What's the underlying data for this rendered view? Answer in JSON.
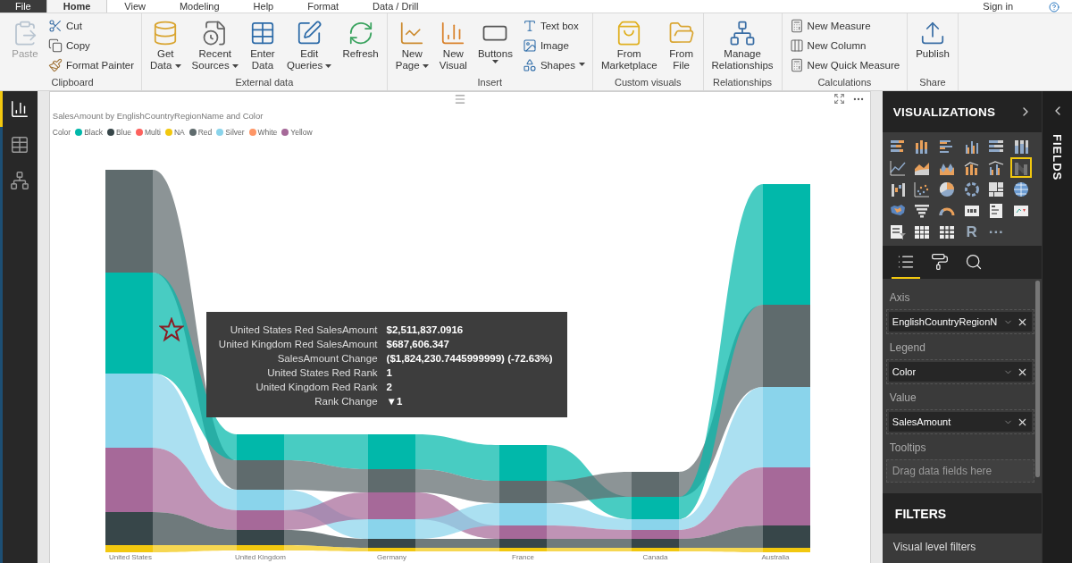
{
  "menu_tabs": [
    {
      "label": "File",
      "kind": "file",
      "selected": false
    },
    {
      "label": "Home",
      "kind": "tab",
      "selected": true
    },
    {
      "label": "View",
      "kind": "tab",
      "selected": false
    },
    {
      "label": "Modeling",
      "kind": "tab",
      "selected": false
    },
    {
      "label": "Help",
      "kind": "tab",
      "selected": false
    },
    {
      "label": "Format",
      "kind": "tab",
      "selected": false
    },
    {
      "label": "Data / Drill",
      "kind": "tab",
      "selected": false
    }
  ],
  "account": {
    "label": "Sign in"
  },
  "ribbon": {
    "groups": [
      {
        "label": "Clipboard",
        "items": [
          {
            "kind": "large",
            "lines": [
              "Paste"
            ],
            "dropdown": false,
            "disabled": true
          },
          {
            "kind": "small",
            "lines": [
              "Cut"
            ],
            "dropdown": false,
            "disabled": false
          },
          {
            "kind": "small",
            "lines": [
              "Copy"
            ],
            "dropdown": false,
            "disabled": false
          },
          {
            "kind": "small",
            "lines": [
              "Format Painter"
            ],
            "dropdown": false,
            "disabled": false
          }
        ]
      },
      {
        "label": "External data",
        "items": [
          {
            "kind": "large",
            "lines": [
              "Get",
              "Data"
            ],
            "dropdown": true,
            "disabled": false
          },
          {
            "kind": "large",
            "lines": [
              "Recent",
              "Sources"
            ],
            "dropdown": true,
            "disabled": false
          },
          {
            "kind": "large",
            "lines": [
              "Enter",
              "Data"
            ],
            "dropdown": false,
            "disabled": false
          },
          {
            "kind": "large",
            "lines": [
              "Edit",
              "Queries"
            ],
            "dropdown": true,
            "disabled": false
          },
          {
            "kind": "large",
            "lines": [
              "Refresh"
            ],
            "dropdown": false,
            "disabled": false
          }
        ]
      },
      {
        "label": "Insert",
        "items": [
          {
            "kind": "large",
            "lines": [
              "New",
              "Page"
            ],
            "dropdown": true,
            "disabled": false
          },
          {
            "kind": "large",
            "lines": [
              "New",
              "Visual"
            ],
            "dropdown": false,
            "disabled": false
          },
          {
            "kind": "large",
            "lines": [
              "Buttons"
            ],
            "dropdown": true,
            "disabled": false
          },
          {
            "kind": "small",
            "lines": [
              "Text box"
            ],
            "dropdown": false,
            "disabled": false
          },
          {
            "kind": "small",
            "lines": [
              "Image"
            ],
            "dropdown": false,
            "disabled": false
          },
          {
            "kind": "small",
            "lines": [
              "Shapes"
            ],
            "dropdown": true,
            "disabled": false
          }
        ]
      },
      {
        "label": "Custom visuals",
        "items": [
          {
            "kind": "large",
            "lines": [
              "From",
              "Marketplace"
            ],
            "dropdown": false,
            "disabled": false
          },
          {
            "kind": "large",
            "lines": [
              "From",
              "File"
            ],
            "dropdown": false,
            "disabled": false
          }
        ]
      },
      {
        "label": "Relationships",
        "items": [
          {
            "kind": "large",
            "lines": [
              "Manage",
              "Relationships"
            ],
            "dropdown": false,
            "disabled": false
          }
        ]
      },
      {
        "label": "Calculations",
        "items": [
          {
            "kind": "small",
            "lines": [
              "New Measure"
            ],
            "dropdown": false,
            "disabled": false
          },
          {
            "kind": "small",
            "lines": [
              "New Column"
            ],
            "dropdown": false,
            "disabled": false
          },
          {
            "kind": "small",
            "lines": [
              "New Quick Measure"
            ],
            "dropdown": false,
            "disabled": false
          }
        ]
      },
      {
        "label": "Share",
        "items": [
          {
            "kind": "large",
            "lines": [
              "Publish"
            ],
            "dropdown": false,
            "disabled": false
          }
        ]
      }
    ]
  },
  "nav": [
    {
      "selected": true
    },
    {
      "selected": false
    },
    {
      "selected": false
    }
  ],
  "visual": {
    "title": "SalesAmount by EnglishCountryRegionName and Color",
    "legend_title": "Color",
    "legend": [
      {
        "name": "Black",
        "color": "#01b8aa"
      },
      {
        "name": "Blue",
        "color": "#374649"
      },
      {
        "name": "Multi",
        "color": "#fd625e"
      },
      {
        "name": "NA",
        "color": "#f2c80f"
      },
      {
        "name": "Red",
        "color": "#5f6b6d"
      },
      {
        "name": "Silver",
        "color": "#8ad4eb"
      },
      {
        "name": "White",
        "color": "#fe9666"
      },
      {
        "name": "Yellow",
        "color": "#a66999"
      }
    ],
    "axis_labels": [
      "United States",
      "United Kingdom",
      "Germany",
      "France",
      "Canada",
      "Australia"
    ],
    "tooltip": [
      {
        "label": "United States Red SalesAmount",
        "value": "$2,511,837.0916"
      },
      {
        "label": "United Kingdom Red SalesAmount",
        "value": "$687,606.347"
      },
      {
        "label": "SalesAmount Change",
        "value": "($1,824,230.7445999999) (-72.63%)"
      },
      {
        "label": "United States Red Rank",
        "value": "1"
      },
      {
        "label": "United Kingdom Red Rank",
        "value": "2"
      },
      {
        "label": "Rank Change",
        "value": "▼1"
      }
    ]
  },
  "visualizations": {
    "title": "VISUALIZATIONS",
    "gallery": [
      {
        "kind": "chart",
        "selected": false
      },
      {
        "kind": "chart",
        "selected": false
      },
      {
        "kind": "chart",
        "selected": false
      },
      {
        "kind": "chart",
        "selected": false
      },
      {
        "kind": "chart",
        "selected": false
      },
      {
        "kind": "chart",
        "selected": false
      },
      {
        "kind": "chart",
        "selected": false
      },
      {
        "kind": "chart",
        "selected": false
      },
      {
        "kind": "chart",
        "selected": false
      },
      {
        "kind": "chart",
        "selected": false
      },
      {
        "kind": "chart",
        "selected": false
      },
      {
        "kind": "chart",
        "selected": true
      },
      {
        "kind": "chart",
        "selected": false
      },
      {
        "kind": "chart",
        "selected": false
      },
      {
        "kind": "chart",
        "selected": false
      },
      {
        "kind": "chart",
        "selected": false
      },
      {
        "kind": "chart",
        "selected": false
      },
      {
        "kind": "chart",
        "selected": false
      },
      {
        "kind": "chart",
        "selected": false
      },
      {
        "kind": "chart",
        "selected": false
      },
      {
        "kind": "chart",
        "selected": false
      },
      {
        "kind": "chart",
        "selected": false
      },
      {
        "kind": "chart",
        "selected": false
      },
      {
        "kind": "chart",
        "selected": false
      },
      {
        "kind": "chart",
        "selected": false
      },
      {
        "kind": "chart",
        "selected": false
      },
      {
        "kind": "chart",
        "selected": false
      },
      {
        "kind": "glyph",
        "glyph": "R",
        "selected": false
      },
      {
        "kind": "glyph",
        "glyph": "···",
        "selected": false
      }
    ],
    "pane_tabs": [
      {
        "selected": true
      },
      {
        "selected": false
      },
      {
        "selected": false
      }
    ],
    "wells": [
      {
        "label": "Axis",
        "field": "EnglishCountryRegionN"
      },
      {
        "label": "Legend",
        "field": "Color"
      },
      {
        "label": "Value",
        "field": "SalesAmount"
      },
      {
        "label": "Tooltips",
        "placeholder": "Drag data fields here"
      }
    ]
  },
  "filters": {
    "title": "FILTERS",
    "section": "Visual level filters"
  },
  "fields_pane": {
    "title": "FIELDS"
  }
}
